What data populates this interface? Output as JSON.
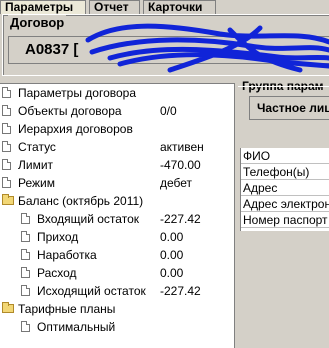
{
  "tabs": [
    "Параметры",
    "Отчет",
    "Карточки"
  ],
  "contract": {
    "caption": "Договор",
    "value": "A0837 [ "
  },
  "tree": [
    {
      "label": "Параметры договора",
      "value": "",
      "icon": "document-icon"
    },
    {
      "label": "Объекты договора",
      "value": "0/0",
      "icon": "document-icon"
    },
    {
      "label": "Иерархия договоров",
      "value": "",
      "icon": "document-icon"
    },
    {
      "label": "Статус",
      "value": "активен",
      "icon": "document-icon"
    },
    {
      "label": "Лимит",
      "value": "-470.00",
      "icon": "document-icon"
    },
    {
      "label": "Режим",
      "value": "дебет",
      "icon": "document-icon"
    },
    {
      "label": "Баланс (октябрь 2011)",
      "value": "",
      "icon": "folder-icon"
    },
    {
      "label": "Входящий остаток",
      "value": "-227.42",
      "icon": "document-icon"
    },
    {
      "label": "Приход",
      "value": "0.00",
      "icon": "document-icon"
    },
    {
      "label": "Наработка",
      "value": "0.00",
      "icon": "document-icon"
    },
    {
      "label": "Расход",
      "value": "0.00",
      "icon": "document-icon"
    },
    {
      "label": "Исходящий остаток",
      "value": "-227.42",
      "icon": "document-icon"
    },
    {
      "label": "Тарифные планы",
      "value": "",
      "icon": "folder-icon"
    },
    {
      "label": "Оптимальный",
      "value": "",
      "icon": "document-icon"
    }
  ],
  "group": {
    "caption": "Группа парам",
    "button_label": "Частное лиц"
  },
  "grid_rows": [
    "ФИО",
    "Телефон(ы)",
    "Адрес",
    "Адрес электрон",
    "Номер паспорт"
  ]
}
